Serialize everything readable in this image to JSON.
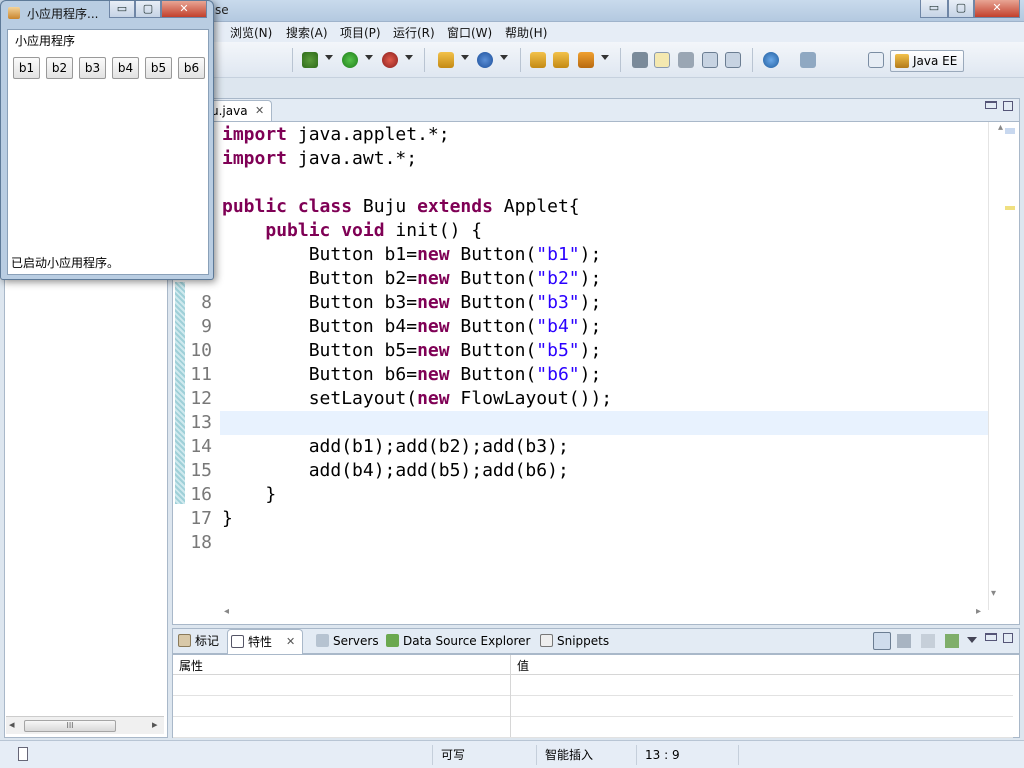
{
  "main_window": {
    "title_fragment": "se",
    "min_label": "▭",
    "max_label": "▢",
    "close_label": "✕"
  },
  "menu": [
    "浏览(N)",
    "搜索(A)",
    "项目(P)",
    "运行(R)",
    "窗口(W)",
    "帮助(H)"
  ],
  "toolbar": {
    "perspective_label": "Java EE"
  },
  "editor": {
    "tab_label": "u.java",
    "tab_close": "✕",
    "line_numbers": [
      "8",
      "9",
      "10",
      "11",
      "12",
      "13",
      "14",
      "15",
      "16",
      "17",
      "18"
    ],
    "code_lines": [
      {
        "parts": [
          {
            "t": "import",
            "k": "kw"
          },
          {
            "t": " java.applet.*;"
          }
        ]
      },
      {
        "parts": [
          {
            "t": "import",
            "k": "kw"
          },
          {
            "t": " java.awt.*;"
          }
        ]
      },
      {
        "parts": [
          {
            "t": ""
          }
        ]
      },
      {
        "parts": [
          {
            "t": "public class",
            "k": "kw"
          },
          {
            "t": " Buju "
          },
          {
            "t": "extends",
            "k": "kw"
          },
          {
            "t": " Applet{"
          }
        ]
      },
      {
        "parts": [
          {
            "t": "    "
          },
          {
            "t": "public void",
            "k": "kw"
          },
          {
            "t": " init() {"
          }
        ]
      },
      {
        "parts": [
          {
            "t": "        Button b1="
          },
          {
            "t": "new",
            "k": "kw"
          },
          {
            "t": " Button("
          },
          {
            "t": "\"b1\"",
            "k": "str"
          },
          {
            "t": ");"
          }
        ]
      },
      {
        "parts": [
          {
            "t": "        Button b2="
          },
          {
            "t": "new",
            "k": "kw"
          },
          {
            "t": " Button("
          },
          {
            "t": "\"b2\"",
            "k": "str"
          },
          {
            "t": ");"
          }
        ]
      },
      {
        "parts": [
          {
            "t": "        Button b3="
          },
          {
            "t": "new",
            "k": "kw"
          },
          {
            "t": " Button("
          },
          {
            "t": "\"b3\"",
            "k": "str"
          },
          {
            "t": ");"
          }
        ]
      },
      {
        "parts": [
          {
            "t": "        Button b4="
          },
          {
            "t": "new",
            "k": "kw"
          },
          {
            "t": " Button("
          },
          {
            "t": "\"b4\"",
            "k": "str"
          },
          {
            "t": ");"
          }
        ]
      },
      {
        "parts": [
          {
            "t": "        Button b5="
          },
          {
            "t": "new",
            "k": "kw"
          },
          {
            "t": " Button("
          },
          {
            "t": "\"b5\"",
            "k": "str"
          },
          {
            "t": ");"
          }
        ]
      },
      {
        "parts": [
          {
            "t": "        Button b6="
          },
          {
            "t": "new",
            "k": "kw"
          },
          {
            "t": " Button("
          },
          {
            "t": "\"b6\"",
            "k": "str"
          },
          {
            "t": ");"
          }
        ]
      },
      {
        "parts": [
          {
            "t": "        setLayout("
          },
          {
            "t": "new",
            "k": "kw"
          },
          {
            "t": " FlowLayout());"
          }
        ]
      },
      {
        "parts": [
          {
            "t": ""
          }
        ]
      },
      {
        "parts": [
          {
            "t": "        add(b1);add(b2);add(b3);"
          }
        ]
      },
      {
        "parts": [
          {
            "t": "        add(b4);add(b5);add(b6);"
          }
        ]
      },
      {
        "parts": [
          {
            "t": "    }"
          }
        ]
      },
      {
        "parts": [
          {
            "t": "}"
          }
        ]
      },
      {
        "parts": [
          {
            "t": ""
          }
        ]
      }
    ]
  },
  "bottom_panel": {
    "tabs": [
      "标记",
      "特性",
      "Servers",
      "Data Source Explorer",
      "Snippets"
    ],
    "active_tab_close": "✕",
    "col_property": "属性",
    "col_value": "值"
  },
  "status": {
    "writable": "可写",
    "insert_mode": "智能插入",
    "position": "13 : 9"
  },
  "applet": {
    "title": "小应用程序...",
    "menu_label": "小应用程序",
    "buttons": [
      "b1",
      "b2",
      "b3",
      "b4",
      "b5",
      "b6"
    ],
    "status": "已启动小应用程序。"
  },
  "scroll": {
    "grip": "III",
    "left_arrow": "◂",
    "right_arrow": "▸",
    "up_arrow": "▴",
    "down_arrow": "▾"
  }
}
